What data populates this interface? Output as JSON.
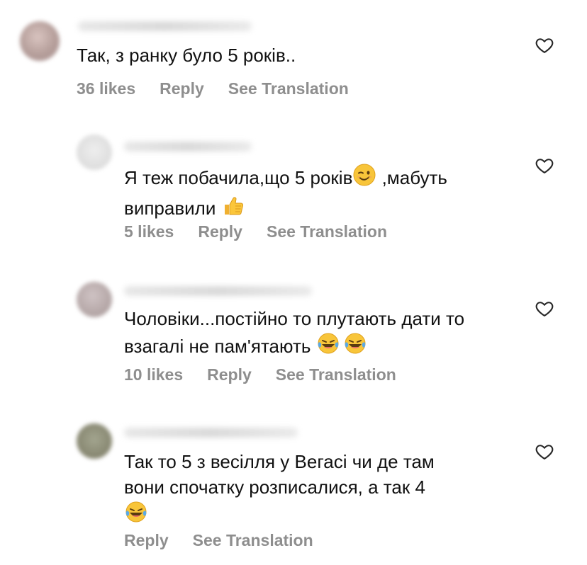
{
  "comments": [
    {
      "text": "Так, з ранку було 5 років..",
      "likes": "36 likes",
      "reply": "Reply",
      "translate": "See Translation"
    },
    {
      "text_line1_pre": "Я  теж побачила,що 5 років",
      "text_line1_post": " ,мабуть",
      "text_line2": "виправили ",
      "likes": "5 likes",
      "reply": "Reply",
      "translate": "See Translation"
    },
    {
      "text_line1": "Чоловіки...постійно то плутають дати то",
      "text_line2": "взагалі не пам'ятають ",
      "likes": "10 likes",
      "reply": "Reply",
      "translate": "See Translation"
    },
    {
      "text_line1": "Так то 5 з весілля у Вегасі чи де там",
      "text_line2": "вони спочатку розписалися,  а  так 4",
      "reply": "Reply",
      "translate": "See Translation"
    }
  ],
  "icons": {
    "heart": "heart-outline-icon",
    "wink": "wink-emoji",
    "thumbs_up": "thumbs-up-emoji",
    "laugh": "tears-of-joy-emoji"
  }
}
